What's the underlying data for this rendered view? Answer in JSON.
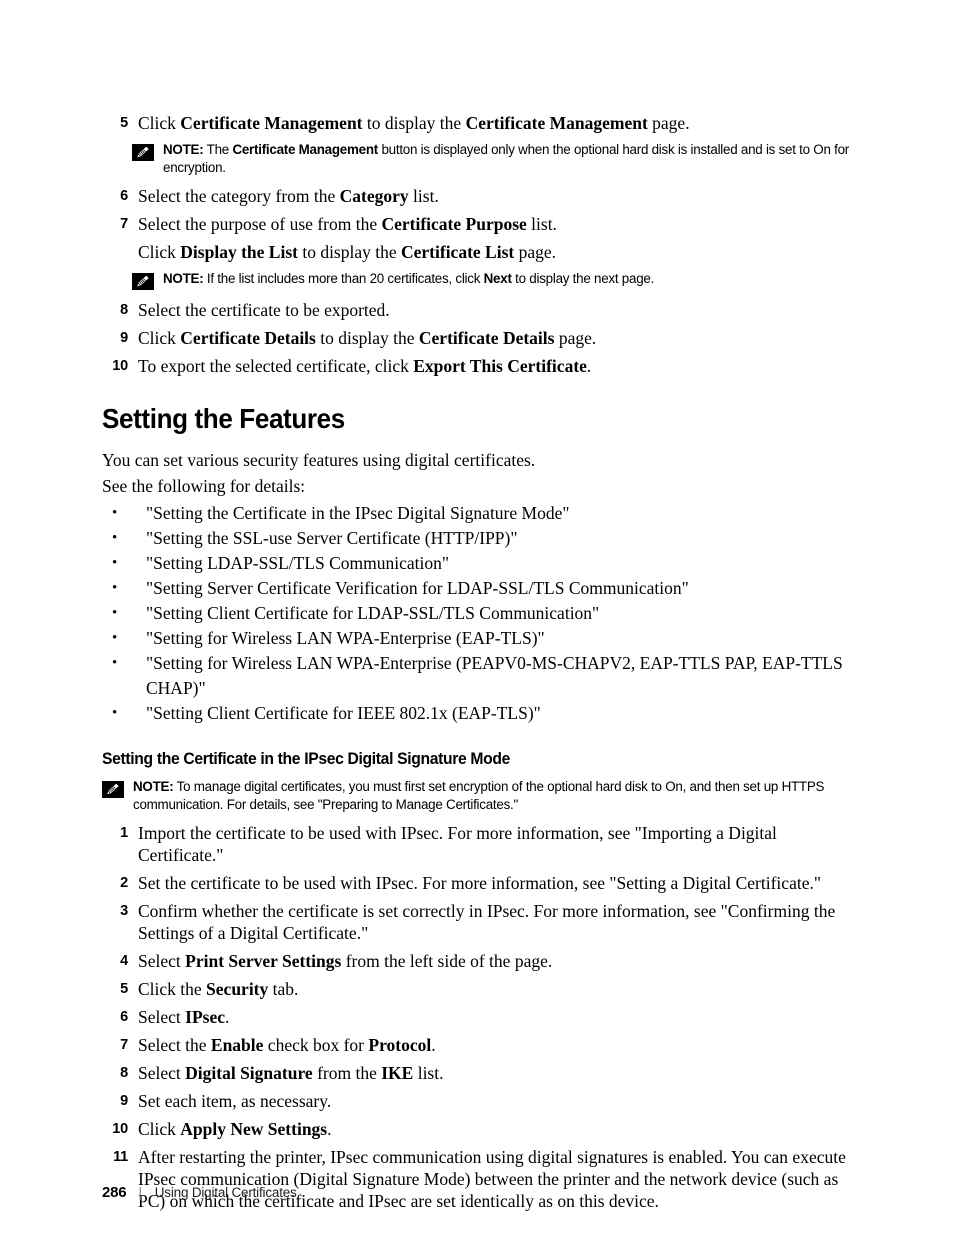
{
  "document": {
    "heading": "Setting the Features",
    "subheading": "Setting the Certificate in the IPsec Digital Signature Mode",
    "intro_line_1": "You can set various security features using digital certificates.",
    "intro_line_2": "See the following for details:"
  },
  "steps_export": [
    {
      "num": "5",
      "parts": [
        {
          "t": "Click ",
          "b": false
        },
        {
          "t": "Certificate Management",
          "b": true
        },
        {
          "t": " to display the ",
          "b": false
        },
        {
          "t": "Certificate Management",
          "b": true
        },
        {
          "t": " page.",
          "b": false
        }
      ]
    },
    {
      "num": "6",
      "parts": [
        {
          "t": "Select the category from the ",
          "b": false
        },
        {
          "t": "Category",
          "b": true
        },
        {
          "t": " list.",
          "b": false
        }
      ]
    },
    {
      "num": "7",
      "parts": [
        {
          "t": "Select the purpose of use from the ",
          "b": false
        },
        {
          "t": "Certificate Purpose",
          "b": true
        },
        {
          "t": " list.",
          "b": false
        }
      ],
      "sub_parts": [
        {
          "t": "Click ",
          "b": false
        },
        {
          "t": "Display the List",
          "b": true
        },
        {
          "t": " to display the ",
          "b": false
        },
        {
          "t": "Certificate List",
          "b": true
        },
        {
          "t": " page.",
          "b": false
        }
      ]
    },
    {
      "num": "8",
      "parts": [
        {
          "t": "Select the certificate to be exported.",
          "b": false
        }
      ]
    },
    {
      "num": "9",
      "parts": [
        {
          "t": "Click ",
          "b": false
        },
        {
          "t": "Certificate Details",
          "b": true
        },
        {
          "t": " to display the ",
          "b": false
        },
        {
          "t": "Certificate Details",
          "b": true
        },
        {
          "t": " page.",
          "b": false
        }
      ]
    },
    {
      "num": "10",
      "parts": [
        {
          "t": "To export the selected certificate, click ",
          "b": false
        },
        {
          "t": "Export This Certificate",
          "b": true
        },
        {
          "t": ".",
          "b": false
        }
      ]
    }
  ],
  "note_1": {
    "label": "NOTE:",
    "icon": "note-pencil-icon",
    "parts": [
      {
        "t": " The ",
        "b": false
      },
      {
        "t": "Certificate Management",
        "b": true
      },
      {
        "t": " button is displayed only when the optional hard disk is installed and is set to On for encryption.",
        "b": false
      }
    ]
  },
  "note_2": {
    "label": "NOTE:",
    "icon": "note-pencil-icon",
    "parts": [
      {
        "t": " If the list includes more than 20 certificates, click ",
        "b": false
      },
      {
        "t": "Next",
        "b": true
      },
      {
        "t": " to display the next page.",
        "b": false
      }
    ]
  },
  "note_3": {
    "label": "NOTE:",
    "icon": "note-pencil-icon",
    "parts": [
      {
        "t": " To manage digital certificates, you must first set encryption of the optional hard disk to On, and then set up HTTPS communication. For details, see \"Preparing to Manage Certificates.\"",
        "b": false
      }
    ]
  },
  "feature_links": [
    "\"Setting the Certificate in the IPsec Digital Signature Mode\"",
    "\"Setting the SSL-use Server Certificate (HTTP/IPP)\"",
    "\"Setting LDAP-SSL/TLS Communication\"",
    "\"Setting Server Certificate Verification for LDAP-SSL/TLS Communication\"",
    "\"Setting Client Certificate for LDAP-SSL/TLS Communication\"",
    "\"Setting for Wireless LAN WPA-Enterprise (EAP-TLS)\"",
    "\"Setting for Wireless LAN WPA-Enterprise (PEAPV0-MS-CHAPV2, EAP-TTLS PAP, EAP-TTLS CHAP)\"",
    "\"Setting Client Certificate for IEEE 802.1x (EAP-TLS)\""
  ],
  "bullet_glyph": "•",
  "steps_ipsec": [
    {
      "num": "1",
      "parts": [
        {
          "t": "Import the certificate to be used with IPsec. For more information, see \"Importing a Digital Certificate.\"",
          "b": false
        }
      ]
    },
    {
      "num": "2",
      "parts": [
        {
          "t": "Set the certificate to be used with IPsec. For more information, see \"Setting a Digital Certificate.\"",
          "b": false
        }
      ]
    },
    {
      "num": "3",
      "parts": [
        {
          "t": "Confirm whether the certificate is set correctly in IPsec. For more information, see \"Confirming the Settings of a Digital Certificate.\"",
          "b": false
        }
      ]
    },
    {
      "num": "4",
      "parts": [
        {
          "t": "Select ",
          "b": false
        },
        {
          "t": "Print Server Settings",
          "b": true
        },
        {
          "t": " from the left side of the page.",
          "b": false
        }
      ]
    },
    {
      "num": "5",
      "parts": [
        {
          "t": "Click the ",
          "b": false
        },
        {
          "t": "Security",
          "b": true
        },
        {
          "t": " tab.",
          "b": false
        }
      ]
    },
    {
      "num": "6",
      "parts": [
        {
          "t": "Select ",
          "b": false
        },
        {
          "t": "IPsec",
          "b": true
        },
        {
          "t": ".",
          "b": false
        }
      ]
    },
    {
      "num": "7",
      "parts": [
        {
          "t": "Select the ",
          "b": false
        },
        {
          "t": "Enable",
          "b": true
        },
        {
          "t": " check box for ",
          "b": false
        },
        {
          "t": "Protocol",
          "b": true
        },
        {
          "t": ".",
          "b": false
        }
      ]
    },
    {
      "num": "8",
      "parts": [
        {
          "t": "Select ",
          "b": false
        },
        {
          "t": "Digital Signature",
          "b": true
        },
        {
          "t": " from the ",
          "b": false
        },
        {
          "t": "IKE",
          "b": true
        },
        {
          "t": " list.",
          "b": false
        }
      ]
    },
    {
      "num": "9",
      "parts": [
        {
          "t": "Set each item, as necessary.",
          "b": false
        }
      ]
    },
    {
      "num": "10",
      "parts": [
        {
          "t": "Click ",
          "b": false
        },
        {
          "t": "Apply New Settings",
          "b": true
        },
        {
          "t": ".",
          "b": false
        }
      ]
    },
    {
      "num": "11",
      "parts": [
        {
          "t": "After restarting the printer, IPsec communication using digital signatures is enabled. You can execute IPsec communication (Digital Signature Mode) between the printer and the network device (such as PC) on which the certificate and IPsec are set identically as on this device.",
          "b": false
        }
      ]
    }
  ],
  "footer": {
    "page_number": "286",
    "separator": "|",
    "title": "Using Digital Certificates"
  }
}
